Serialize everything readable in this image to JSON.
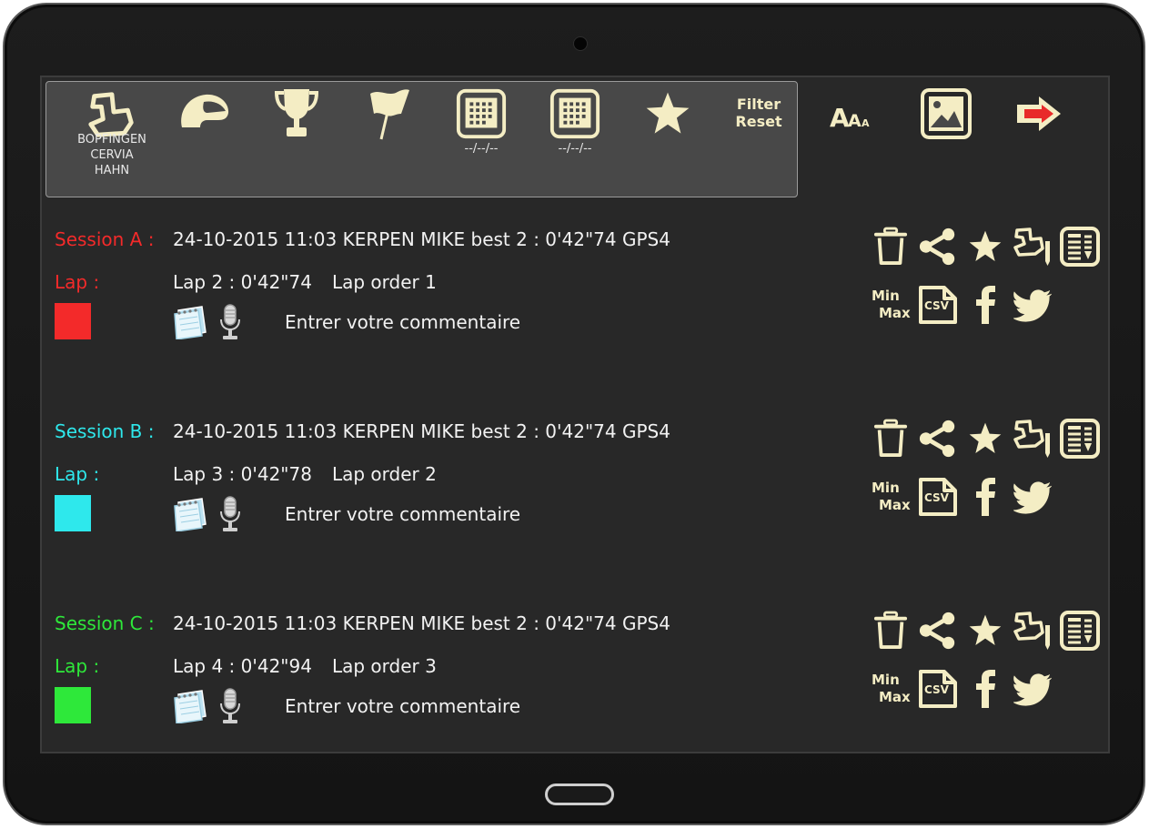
{
  "toolbar": {
    "tracks": [
      "BOPFINGEN",
      "CERVIA",
      "HAHN"
    ],
    "date_from": "--/--/--",
    "date_to": "--/--/--",
    "filter_line1": "Filter",
    "filter_line2": "Reset",
    "icons": [
      "track-icon",
      "helmet-icon",
      "trophy-icon",
      "flag-icon",
      "calendar-icon",
      "calendar-icon",
      "star-icon",
      "font-size-icon",
      "image-icon",
      "exit-arrow-icon"
    ]
  },
  "sessions": [
    {
      "title": "Session A :",
      "info": "24-10-2015 11:03 KERPEN MIKE best 2 : 0'42\"74 GPS4",
      "lap_label": "Lap :",
      "lap_info": "Lap 2 : 0'42\"74",
      "lap_order": "Lap order 1",
      "color": "#f32a2a",
      "comment": "Entrer votre commentaire"
    },
    {
      "title": "Session B :",
      "info": "24-10-2015 11:03 KERPEN MIKE best 2 : 0'42\"74 GPS4",
      "lap_label": "Lap :",
      "lap_info": "Lap 3 : 0'42\"78",
      "lap_order": "Lap order 2",
      "color": "#2ee8ec",
      "comment": "Entrer votre commentaire"
    },
    {
      "title": "Session C :",
      "info": "24-10-2015 11:03 KERPEN MIKE best 2 : 0'42\"74 GPS4",
      "lap_label": "Lap :",
      "lap_info": "Lap 4 : 0'42\"94",
      "lap_order": "Lap order 3",
      "color": "#2ee83a",
      "comment": "Entrer votre commentaire"
    }
  ],
  "actions": {
    "minmax_line1": "Min",
    "minmax_line2": "Max",
    "csv_label": "CSV",
    "icons": [
      "trash-icon",
      "share-icon",
      "star-icon",
      "track-edit-icon",
      "report-icon",
      "minmax-icon",
      "csv-icon",
      "facebook-icon",
      "twitter-icon"
    ]
  },
  "colors": {
    "icon_cream": "#f4edc4",
    "screen_bg": "#282828",
    "panel_bg": "#484848"
  }
}
